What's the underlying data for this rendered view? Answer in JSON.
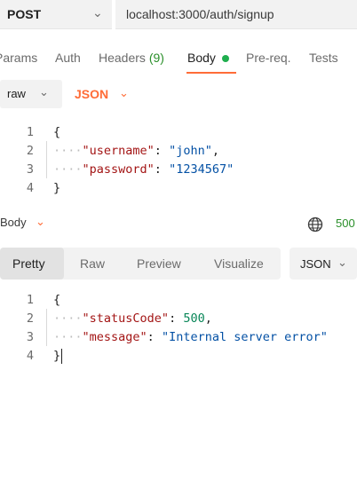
{
  "request": {
    "method": "POST",
    "method_chevron": "⌄",
    "url": "localhost:3000/auth/signup"
  },
  "request_tabs": {
    "params": "Params",
    "auth": "Auth",
    "headers": "Headers",
    "headers_count": "(9)",
    "body": "Body",
    "prereq": "Pre-req.",
    "tests": "Tests"
  },
  "body_options": {
    "mode": "raw",
    "mode_chevron": "⌄",
    "language": "JSON",
    "language_chevron": "⌄"
  },
  "request_body": {
    "line_numbers": [
      "1",
      "2",
      "3",
      "4"
    ],
    "open_brace": "{",
    "close_brace": "}",
    "indent": "····",
    "lines": [
      {
        "key": "\"username\"",
        "sep": ": ",
        "value": "\"john\"",
        "trail": ","
      },
      {
        "key": "\"password\"",
        "sep": ": ",
        "value": "\"1234567\"",
        "trail": ""
      }
    ]
  },
  "response": {
    "body_label": "Body",
    "body_chevron": "⌄",
    "status_code": "500",
    "colors": {
      "accent": "#ff6c37",
      "status": "#2a8f2a"
    }
  },
  "response_view": {
    "tabs": [
      "Pretty",
      "Raw",
      "Preview",
      "Visualize"
    ],
    "active": "Pretty",
    "format": "JSON",
    "format_chevron": "⌄"
  },
  "response_body": {
    "line_numbers": [
      "1",
      "2",
      "3",
      "4"
    ],
    "open_brace": "{",
    "close_brace": "}",
    "indent": "····",
    "lines": [
      {
        "key": "\"statusCode\"",
        "sep": ": ",
        "value": "500",
        "trail": ","
      },
      {
        "key": "\"message\"",
        "sep": ": ",
        "value": "\"Internal server error\"",
        "trail": ""
      }
    ]
  }
}
